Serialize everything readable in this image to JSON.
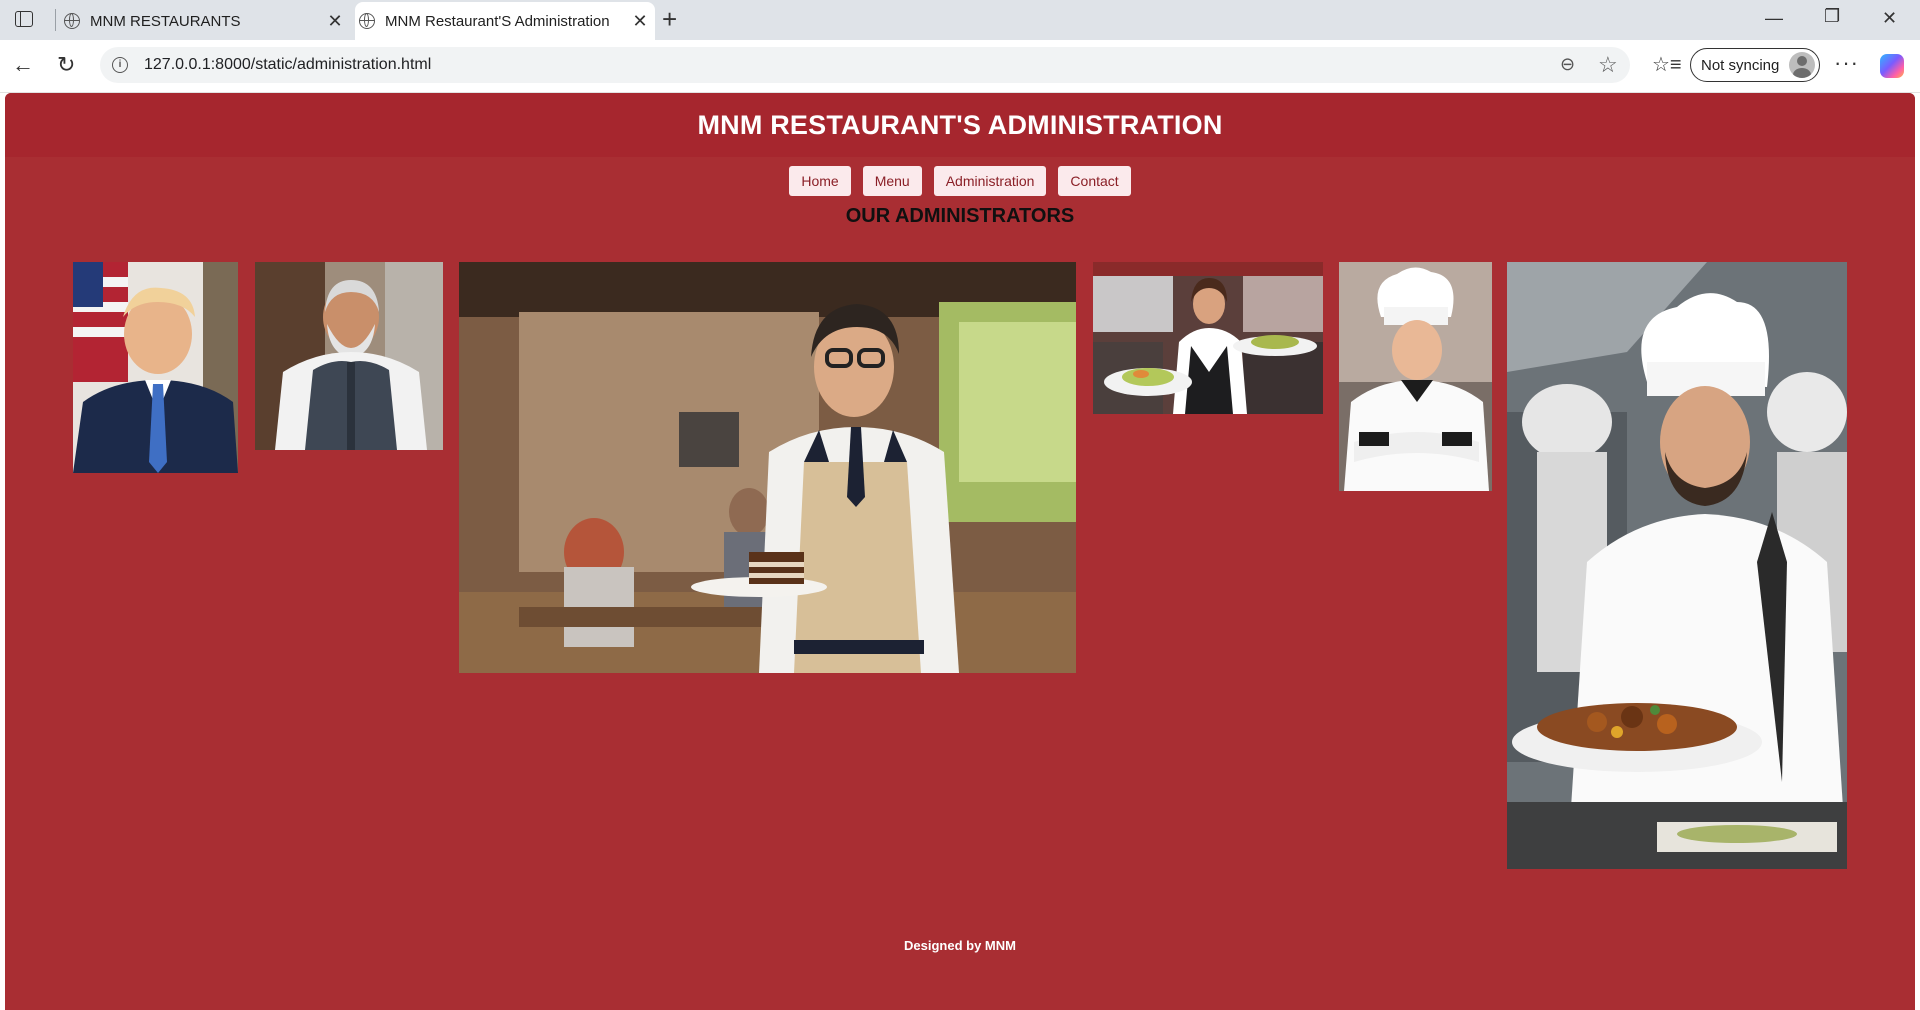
{
  "browser": {
    "tabs": [
      {
        "title": "MNM RESTAURANTS",
        "active": false
      },
      {
        "title": "MNM Restaurant'S Administration",
        "active": true
      }
    ],
    "url": "127.0.0.1:8000/static/administration.html",
    "sync_label": "Not syncing"
  },
  "page": {
    "title": "MNM RESTAURANT'S ADMINISTRATION",
    "nav": [
      "Home",
      "Menu",
      "Administration",
      "Contact"
    ],
    "section_title": "OUR ADMINISTRATORS",
    "footer": "Designed by MNM"
  },
  "colors": {
    "page_background": "#a92e33",
    "header_background": "#a6262e",
    "nav_button_background": "#fbeaec",
    "nav_button_text": "#8a1f26"
  },
  "photos": [
    {
      "subject": "man in navy suit and blue tie before an American flag"
    },
    {
      "subject": "bearded man in white kurta and grey vest"
    },
    {
      "subject": "smiling waiter with glasses and apron holding cake slice in a restaurant"
    },
    {
      "subject": "waitress in vest carrying two plates at a bar"
    },
    {
      "subject": "female chef in white toque with arms crossed"
    },
    {
      "subject": "bearded chef in white toque holding plated dish in a kitchen"
    }
  ]
}
